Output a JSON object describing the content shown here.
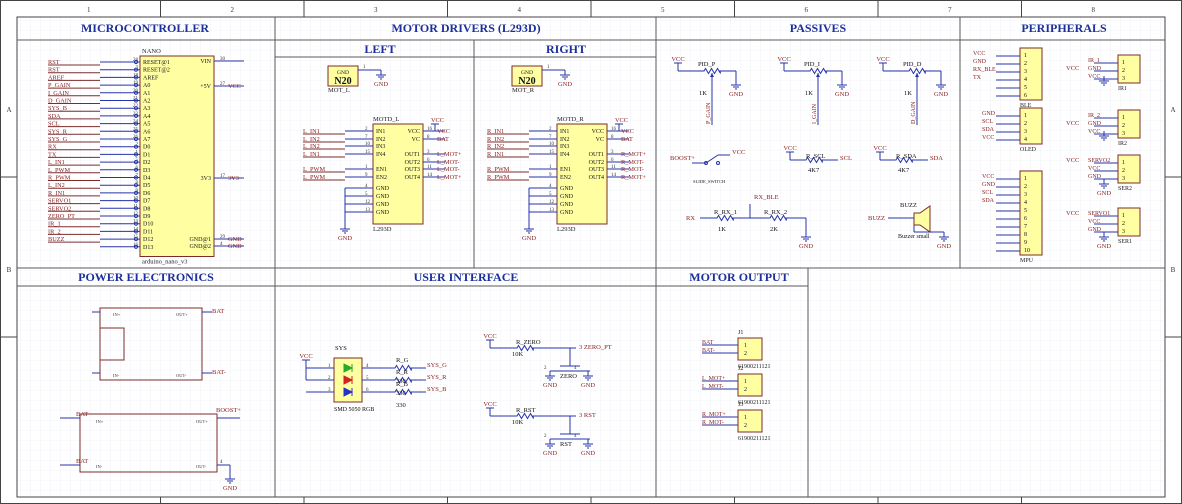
{
  "sheet": {
    "col_labels": [
      "1",
      "2",
      "3",
      "4",
      "5",
      "6",
      "7",
      "8"
    ],
    "row_labels": [
      "A",
      "B"
    ]
  },
  "sections": {
    "microcontroller": "MICROCONTROLLER",
    "motor_drivers": "MOTOR DRIVERS (L293D)",
    "left": "LEFT",
    "right": "RIGHT",
    "passives": "PASSIVES",
    "peripherals": "PERIPHERALS",
    "power": "POWER ELECTRONICS",
    "ui": "USER INTERFACE",
    "motor_output": "MOTOR OUTPUT"
  },
  "nano": {
    "ref": "NANO",
    "name": "arduino_nano_v3",
    "left_pins": [
      "RESET@1",
      "RESET@2",
      "AREF",
      "A0",
      "A1",
      "A2",
      "A3",
      "A4",
      "A5",
      "A6",
      "A7",
      "D0",
      "D1",
      "D2",
      "D3",
      "D4",
      "D5",
      "D6",
      "D7",
      "D8",
      "D9",
      "D10",
      "D11",
      "D12",
      "D13"
    ],
    "left_nets": [
      "RST",
      "RST",
      "AREF",
      "P_GAIN",
      "I_GAIN",
      "D_GAIN",
      "SYS_B",
      "SDA",
      "SCL",
      "SYS_R",
      "SYS_G",
      "RX",
      "TX",
      "L_IN1",
      "L_PWM",
      "R_PWM",
      "L_IN2",
      "R_IN1",
      "SERVO1",
      "SERVO2",
      "ZERO_PT",
      "IR_1",
      "IR_2",
      "BUZZ",
      ""
    ],
    "pin_nums": [
      "28",
      "3",
      "18",
      "19",
      "20",
      "21",
      "22",
      "23",
      "24",
      "25",
      "26",
      "2",
      "1",
      "5",
      "6",
      "7",
      "8",
      "9",
      "10",
      "11",
      "12",
      "13",
      "14",
      "15",
      "16"
    ],
    "right_pins": [
      "VIN",
      "+5V",
      "3V3",
      "GND@1",
      "GND@2"
    ],
    "right_nums": [
      "30",
      "27",
      "17",
      "29",
      "4"
    ],
    "right_nets": [
      "",
      "VCC",
      "3V3",
      "GND",
      "GND"
    ]
  },
  "motl": {
    "n20_ref": "MOT_L",
    "n20_label": "N20",
    "n20_gnd": "GND",
    "ref": "MOTD_L",
    "part": "L293D",
    "left_pins": [
      "IN1",
      "IN2",
      "IN3",
      "IN4",
      "EN1",
      "EN2",
      "GND",
      "GND",
      "GND",
      "GND"
    ],
    "left_nums": [
      "2",
      "7",
      "10",
      "15",
      "1",
      "9",
      "4",
      "5",
      "12",
      "13"
    ],
    "left_nets": [
      "L_IN1",
      "L_IN2",
      "L_IN2",
      "L_IN1",
      "L_PWM",
      "L_PWM",
      "",
      "",
      "",
      ""
    ],
    "right_pins": [
      "VCC",
      "VC",
      "OUT1",
      "OUT2",
      "OUT3",
      "OUT4"
    ],
    "right_nums": [
      "16",
      "8",
      "3",
      "6",
      "11",
      "14"
    ],
    "right_nets": [
      "VCC",
      "BAT",
      "L_MOT+",
      "L_MOT-",
      "L_MOT-",
      "L_MOT+"
    ]
  },
  "motr": {
    "n20_ref": "MOT_R",
    "n20_label": "N20",
    "n20_gnd": "GND",
    "ref": "MOTD_R",
    "part": "L293D",
    "left_nets": [
      "R_IN1",
      "R_IN2",
      "R_IN2",
      "R_IN1",
      "R_PWM",
      "R_PWM",
      "",
      "",
      "",
      ""
    ],
    "right_nets": [
      "VCC",
      "BAT",
      "R_MOT+",
      "R_MOT-",
      "R_MOT-",
      "R_MOT+"
    ]
  },
  "passives": {
    "vcc": "VCC",
    "gnd": "GND",
    "pots": [
      {
        "ref": "PID_P",
        "val": "1K",
        "net": "P_GAIN"
      },
      {
        "ref": "PID_I",
        "val": "1K",
        "net": "I_GAIN"
      },
      {
        "ref": "PID_D",
        "val": "1K",
        "net": "D_GAIN"
      }
    ],
    "boost": {
      "net": "BOOST+",
      "ref": "SLIDE_SWITCH",
      "vcc": "VCC"
    },
    "rscl": {
      "ref": "R_SCL",
      "val": "4K7",
      "net": "SCL"
    },
    "rsda": {
      "ref": "R_SDA",
      "val": "4K7",
      "net": "SDA"
    },
    "rx": {
      "net_in": "RX",
      "net_out": "RX_BLE",
      "r1": "R_RX_1",
      "v1": "1K",
      "r2": "R_RX_2",
      "v2": "2K"
    },
    "buzz": {
      "net": "BUZZ",
      "ref": "BUZZ",
      "val": "Buzzer small"
    }
  },
  "peripherals": {
    "ble": {
      "ref": "BLE",
      "nets": [
        "VCC",
        "GND",
        "RX_BLE",
        "TX",
        "",
        ""
      ],
      "nums": [
        "1",
        "2",
        "3",
        "4",
        "5",
        "6"
      ]
    },
    "oled": {
      "ref": "OLED",
      "nets": [
        "GND",
        "SCL",
        "SDA",
        "VCC"
      ],
      "nums": [
        "1",
        "2",
        "3",
        "4"
      ]
    },
    "mpu": {
      "ref": "MPU",
      "nets": [
        "VCC",
        "GND",
        "SCL",
        "SDA",
        "",
        "",
        "",
        "",
        "",
        ""
      ],
      "nums": [
        "1",
        "2",
        "3",
        "4",
        "5",
        "6",
        "7",
        "8",
        "9",
        "10"
      ]
    },
    "ir1": {
      "ref": "IR1",
      "nets": [
        "IR_1",
        "GND",
        "VCC"
      ],
      "nums": [
        "1",
        "2",
        "3"
      ]
    },
    "ir2": {
      "ref": "IR2",
      "nets": [
        "IR_2",
        "GND",
        "VCC"
      ],
      "nums": [
        "1",
        "2",
        "3"
      ]
    },
    "ser2": {
      "ref": "SER2",
      "nets": [
        "SERVO2",
        "VCC",
        "GND"
      ],
      "nums": [
        "1",
        "2",
        "3"
      ]
    },
    "ser1": {
      "ref": "SER1",
      "nets": [
        "SERVO1",
        "VCC",
        "GND"
      ],
      "nums": [
        "1",
        "2",
        "3"
      ]
    }
  },
  "power": {
    "mod1": {
      "in_p": "IN+",
      "in_m": "IN-",
      "out_p": "OUT+",
      "out_m": "OUT-",
      "net_p": "BAT",
      "net_m": "BAT-"
    },
    "mod2": {
      "in_p": "IN+",
      "in_m": "IN-",
      "out_p": "OUT+",
      "out_m": "OUT-",
      "net_in": "BAT",
      "net_out": "BOOST+",
      "gnd": "GND",
      "pin": "4"
    }
  },
  "ui": {
    "led_ref": "SYS",
    "led_part": "SMD 5050 RGB",
    "vcc": "VCC",
    "res": [
      {
        "ref": "R_G",
        "val": "330",
        "net": "SYS_G",
        "pin": "4"
      },
      {
        "ref": "R_R",
        "val": "330",
        "net": "SYS_R",
        "pin": "5"
      },
      {
        "ref": "R_B",
        "val": "330",
        "net": "SYS_B",
        "pin": "6"
      }
    ],
    "zero": {
      "rref": "R_ZERO",
      "rval": "10K",
      "net": "ZERO_PT",
      "sw": "ZERO",
      "pin": "3"
    },
    "rst": {
      "rref": "R_RST",
      "rval": "10K",
      "net": "RST",
      "sw": "RST",
      "pin": "3"
    }
  },
  "motor_output": {
    "conns": [
      {
        "ref": "J1",
        "part": "61900211121",
        "nets": [
          "BAT",
          "BAT-"
        ]
      },
      {
        "ref": "J2",
        "part": "61900211121",
        "nets": [
          "L_MOT+",
          "L_MOT-"
        ]
      },
      {
        "ref": "J3",
        "part": "61900211121",
        "nets": [
          "R_MOT+",
          "R_MOT-"
        ]
      }
    ]
  },
  "colors": {
    "wire": "#2733a8",
    "body": "#ffffa2",
    "net": "#8b1a1a",
    "section": "#1c2f9c",
    "border": "#7d2b2b",
    "grid": "#e4e8f2"
  }
}
